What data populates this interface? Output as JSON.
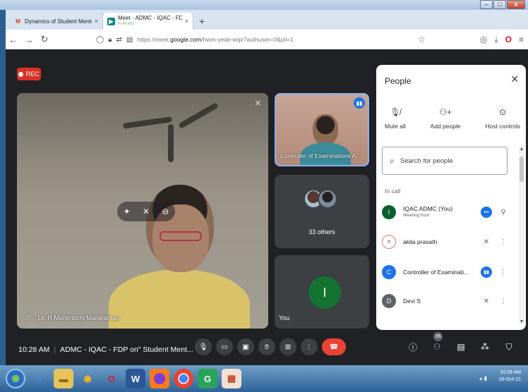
{
  "browser": {
    "tabs": [
      {
        "title": "Dynamics of Student Mentoring",
        "close": "×"
      },
      {
        "title": "Meet - ADMC - IQAC - FDP on\" ",
        "status": "PLAYING",
        "close": "×"
      }
    ],
    "new_tab": "+",
    "url_prefix": "https://meet.",
    "url_host": "google.com",
    "url_path": "/hwm-yede-wqv?authuser=0&pli=1"
  },
  "meet": {
    "rec_label": "REC",
    "main_speaker_name": "Dr. R.Manimozhi Manikantan",
    "tiles": [
      {
        "label": "Controller of Examinations A..."
      },
      {
        "label": "33 others"
      },
      {
        "label": "You",
        "avatar_letter": "I"
      }
    ],
    "time": "10:28 AM",
    "meeting_title": "ADMC - IQAC - FDP on\" Student Ment...",
    "participants_count": "36"
  },
  "people_panel": {
    "title": "People",
    "actions": [
      {
        "label": "Mute all",
        "icon": "mic-off-icon"
      },
      {
        "label": "Add people",
        "icon": "person-add-icon"
      },
      {
        "label": "Host controls",
        "icon": "toggle-icon"
      }
    ],
    "search_placeholder": "Search for people",
    "section_label": "In call",
    "participants": [
      {
        "name": "IQAC ADMC (You)",
        "sub": "Meeting host",
        "initial": "I",
        "color": "#0b5f2f"
      },
      {
        "name": "akila prasath",
        "sub": "",
        "initial": "π",
        "color": "#ffffff"
      },
      {
        "name": "Controller of Examinati...",
        "sub": "",
        "initial": "C",
        "color": "#1a73e8"
      },
      {
        "name": "Devi S",
        "sub": "",
        "initial": "D",
        "color": "#5f6368"
      }
    ]
  },
  "taskbar": {
    "clock_time": "10:28 AM",
    "clock_date": "09-Oct-21"
  }
}
